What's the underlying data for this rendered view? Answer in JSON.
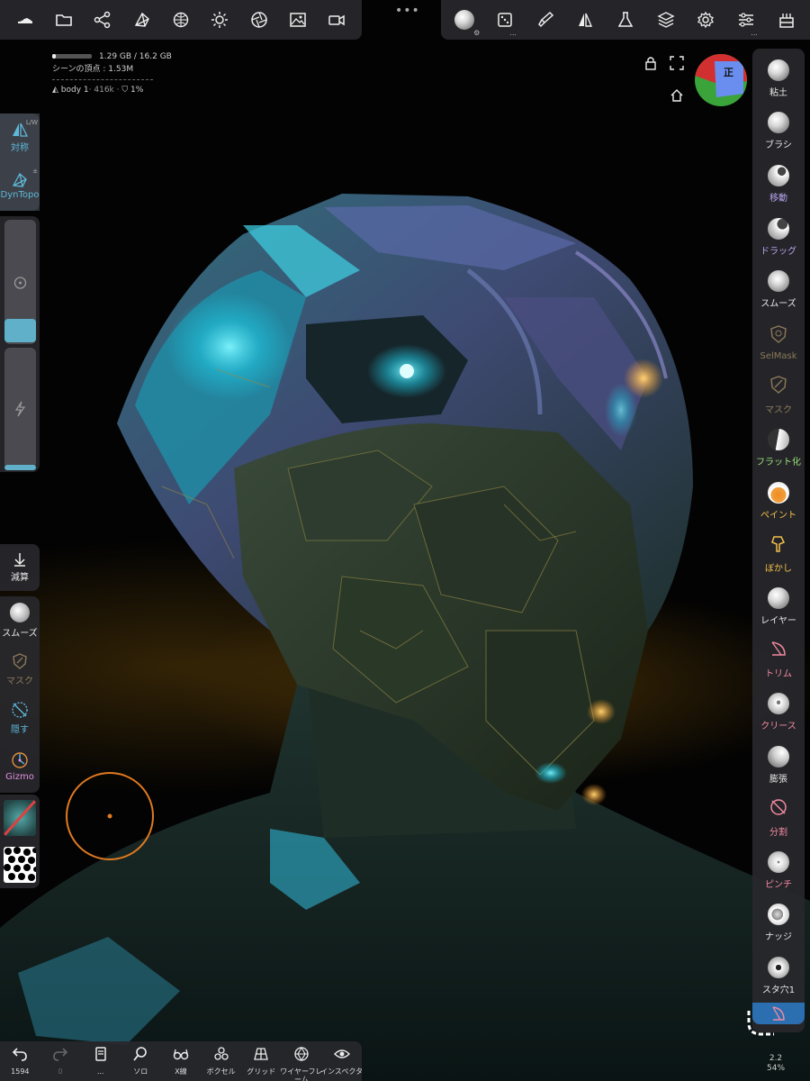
{
  "top_toolbar_left": {
    "icons": [
      "shoe-logo-icon",
      "folder-icon",
      "scene-graph-icon",
      "mesh-icon",
      "sphere-grid-icon",
      "sun-icon",
      "aperture-icon",
      "image-icon",
      "video-camera-icon"
    ]
  },
  "top_toolbar_right": {
    "icons": [
      "material-sphere-icon",
      "dice-icon",
      "paint-brush-icon",
      "symmetry-triangle-icon",
      "flask-icon",
      "layers-icon",
      "gear-icon",
      "sliders-icon",
      "topology-icon"
    ]
  },
  "hud": {
    "memory": "1.29 GB / 16.2 GB",
    "memory_fraction": 0.08,
    "scene_vertices": "シーンの頂点 : 1.53M",
    "object": "body 1",
    "object_stats": "· 416k · ",
    "percent": "1%"
  },
  "orientation_cube": {
    "face_label": "正"
  },
  "left_top": {
    "symmetry": {
      "label": "対称",
      "sup": "L/W"
    },
    "dyntopo": {
      "label": "DynTopo",
      "sup": "±"
    }
  },
  "left_mid": {
    "decimate": {
      "label": "減算"
    }
  },
  "left_tools": [
    {
      "label": "スムーズ",
      "color": "#e8e8e8"
    },
    {
      "label": "マスク",
      "color": "#8c7a5a"
    },
    {
      "label": "隠す",
      "color": "#5fb8d8"
    },
    {
      "label": "Gizmo",
      "color": "#e090e0"
    }
  ],
  "right_tools": [
    {
      "label": "粘土",
      "color": "#e8e8e8"
    },
    {
      "label": "ブラシ",
      "color": "#e8e8e8"
    },
    {
      "label": "移動",
      "color": "#b9a4f0"
    },
    {
      "label": "ドラッグ",
      "color": "#b9a4f0"
    },
    {
      "label": "スムーズ",
      "color": "#e8e8e8"
    },
    {
      "label": "SelMask",
      "color": "#8c7a5a"
    },
    {
      "label": "マスク",
      "color": "#8c7a5a"
    },
    {
      "label": "フラット化",
      "color": "#9be07a"
    },
    {
      "label": "ペイント",
      "color": "#f3c04a"
    },
    {
      "label": "ぼかし",
      "color": "#f3c04a"
    },
    {
      "label": "レイヤー",
      "color": "#e8e8e8"
    },
    {
      "label": "トリム",
      "color": "#f08aa0"
    },
    {
      "label": "クリース",
      "color": "#f08aa0"
    },
    {
      "label": "膨張",
      "color": "#e8e8e8"
    },
    {
      "label": "分割",
      "color": "#f08aa0"
    },
    {
      "label": "ピンチ",
      "color": "#f08aa0"
    },
    {
      "label": "ナッジ",
      "color": "#e8e8e8"
    },
    {
      "label": "スタ穴1",
      "color": "#e8e8e8"
    }
  ],
  "bottom_bar": [
    {
      "label": "1594",
      "icon": "undo-icon"
    },
    {
      "label": "0",
      "icon": "redo-icon"
    },
    {
      "label": "...",
      "icon": "book-icon"
    },
    {
      "label": "ソロ",
      "icon": "search-icon"
    },
    {
      "label": "X線",
      "icon": "glasses-icon"
    },
    {
      "label": "ボクセル",
      "icon": "voxel-icon"
    },
    {
      "label": "グリッド",
      "icon": "grid-icon"
    },
    {
      "label": "ワイヤーフレーム",
      "icon": "wireframe-icon"
    },
    {
      "label": "インスペクタ",
      "icon": "eye-icon"
    }
  ],
  "zoom": {
    "value": "2.2",
    "percent": "54%"
  },
  "colors": {
    "accent": "#5fb0c8",
    "panel": "#28282c",
    "brush_ring": "#e07a20"
  }
}
